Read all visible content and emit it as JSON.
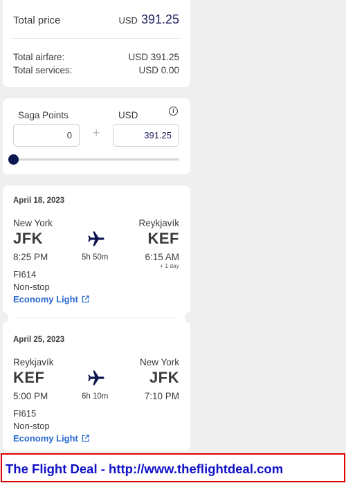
{
  "price": {
    "total_label": "Total price",
    "total_currency": "USD",
    "total_value": "391.25",
    "airfare_label": "Total airfare:",
    "airfare_value": "USD 391.25",
    "services_label": "Total services:",
    "services_value": "USD 0.00"
  },
  "points": {
    "saga_label": "Saga Points",
    "usd_label": "USD",
    "saga_value": "0",
    "usd_value": "391.25",
    "plus": "+",
    "info_icon": "i",
    "slider_fraction": 0
  },
  "flights": [
    {
      "date": "April 18, 2023",
      "from_city": "New York",
      "from_code": "JFK",
      "to_city": "Reykjavík",
      "to_code": "KEF",
      "depart_time": "8:25 PM",
      "arrive_time": "6:15 AM",
      "duration": "5h 50m",
      "plus_day": "+ 1 day",
      "flight_number": "FI614",
      "stops": "Non-stop",
      "fare": "Economy Light"
    },
    {
      "date": "April 25, 2023",
      "from_city": "Reykjavík",
      "from_code": "KEF",
      "to_city": "New York",
      "to_code": "JFK",
      "depart_time": "5:00 PM",
      "arrive_time": "7:10 PM",
      "duration": "6h 10m",
      "flight_number": "FI615",
      "stops": "Non-stop",
      "fare": "Economy Light"
    }
  ],
  "banner": {
    "text": "The Flight Deal - http://www.theflightdeal.com"
  },
  "colors": {
    "accent": "#1a1f5c",
    "link": "#2a6bd1",
    "banner_border": "#e00000",
    "banner_text": "#1010c8"
  }
}
